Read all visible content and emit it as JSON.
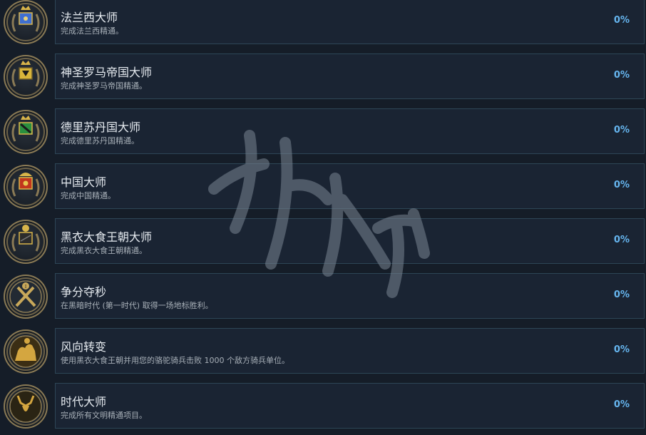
{
  "achievements": [
    {
      "icon": "france-crest-icon",
      "title": "法兰西大师",
      "desc": "完成法兰西精通。",
      "progress": "0%",
      "emblem": "#3f6fd1"
    },
    {
      "icon": "hre-crest-icon",
      "title": "神圣罗马帝国大师",
      "desc": "完成神圣罗马帝国精通。",
      "progress": "0%",
      "emblem": "#d9b53a"
    },
    {
      "icon": "delhi-crest-icon",
      "title": "德里苏丹国大师",
      "desc": "完成德里苏丹国精通。",
      "progress": "0%",
      "emblem": "#2a8f3f"
    },
    {
      "icon": "china-crest-icon",
      "title": "中国大师",
      "desc": "完成中国精通。",
      "progress": "0%",
      "emblem": "#c2361d"
    },
    {
      "icon": "abbasid-crest-icon",
      "title": "黑衣大食王朝大师",
      "desc": "完成黑衣大食王朝精通。",
      "progress": "0%",
      "emblem": "#2c2c2c"
    },
    {
      "icon": "crossed-swords-icon",
      "title": "争分夺秒",
      "desc": "在黑暗时代 (第一时代) 取得一场地标胜利。",
      "progress": "0%",
      "emblem": "#c8a85a"
    },
    {
      "icon": "camel-rider-icon",
      "title": "风向转变",
      "desc": "使用黑衣大食王朝并用您的骆驼骑兵击败 1000 个敌方骑兵单位。",
      "progress": "0%",
      "emblem": "#d4a640"
    },
    {
      "icon": "antler-crest-icon",
      "title": "时代大师",
      "desc": "完成所有文明精通项目。",
      "progress": "0%",
      "emblem": "#d4a640"
    }
  ]
}
